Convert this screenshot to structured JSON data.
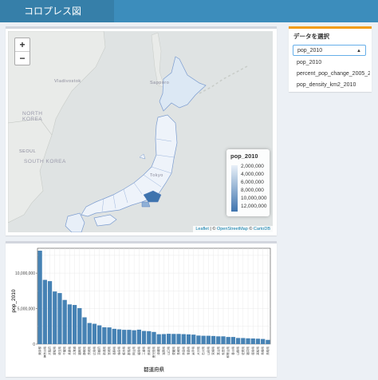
{
  "app": {
    "title": "コロプレス図"
  },
  "map": {
    "zoom_in": "+",
    "zoom_out": "−",
    "labels": {
      "vladivostok": "Vladivostok",
      "north_korea": "NORTH\nKOREA",
      "seoul": "SEOUL",
      "south_korea": "SOUTH KOREA",
      "tokyo": "Tokyo",
      "sapporo": "Sapporo"
    },
    "legend": {
      "title": "pop_2010",
      "labels": [
        "2,000,000",
        "4,000,000",
        "6,000,000",
        "8,000,000",
        "10,000,000",
        "12,000,000"
      ],
      "colors": [
        "#e8f0f8",
        "#3f74ae"
      ]
    },
    "attribution": {
      "leaflet": "Leaflet",
      "sep": " | © ",
      "osm": "OpenStreetMap",
      "mid": " © ",
      "carto": "CartoDB"
    }
  },
  "sidebar": {
    "label": "データを選択",
    "selected": "pop_2010",
    "options": [
      "pop_2010",
      "percent_pop_change_2005_2010",
      "pop_density_km2_2010"
    ]
  },
  "chart_data": {
    "type": "bar",
    "xlabel": "都道府県",
    "ylabel": "pop_2010",
    "ylim": [
      0,
      13500000
    ],
    "yticks": [
      0,
      5000000,
      10000000
    ],
    "ytick_labels": [
      "0",
      "5,000,000",
      "10,000,000"
    ],
    "color": "#4682b4",
    "categories": [
      "東京都",
      "神奈川県",
      "大阪府",
      "愛知県",
      "埼玉県",
      "千葉県",
      "兵庫県",
      "北海道",
      "福岡県",
      "静岡県",
      "茨城県",
      "広島県",
      "京都府",
      "新潟県",
      "宮城県",
      "長野県",
      "岐阜県",
      "栃木県",
      "群馬県",
      "岡山県",
      "福島県",
      "三重県",
      "熊本県",
      "鹿児島県",
      "沖縄県",
      "滋賀県",
      "山口県",
      "愛媛県",
      "長崎県",
      "奈良県",
      "青森県",
      "岩手県",
      "大分県",
      "石川県",
      "山形県",
      "宮崎県",
      "富山県",
      "秋田県",
      "和歌山県",
      "香川県",
      "山梨県",
      "佐賀県",
      "福井県",
      "徳島県",
      "高知県",
      "島根県",
      "鳥取県"
    ],
    "values": [
      13160000,
      9050000,
      8870000,
      7410000,
      7190000,
      6220000,
      5590000,
      5510000,
      5070000,
      3770000,
      2970000,
      2860000,
      2640000,
      2370000,
      2350000,
      2150000,
      2080000,
      2010000,
      2010000,
      1950000,
      2030000,
      1850000,
      1820000,
      1710000,
      1390000,
      1410000,
      1450000,
      1430000,
      1430000,
      1400000,
      1370000,
      1330000,
      1200000,
      1170000,
      1170000,
      1140000,
      1090000,
      1090000,
      1000000,
      1000000,
      860000,
      850000,
      810000,
      790000,
      760000,
      720000,
      590000
    ]
  }
}
